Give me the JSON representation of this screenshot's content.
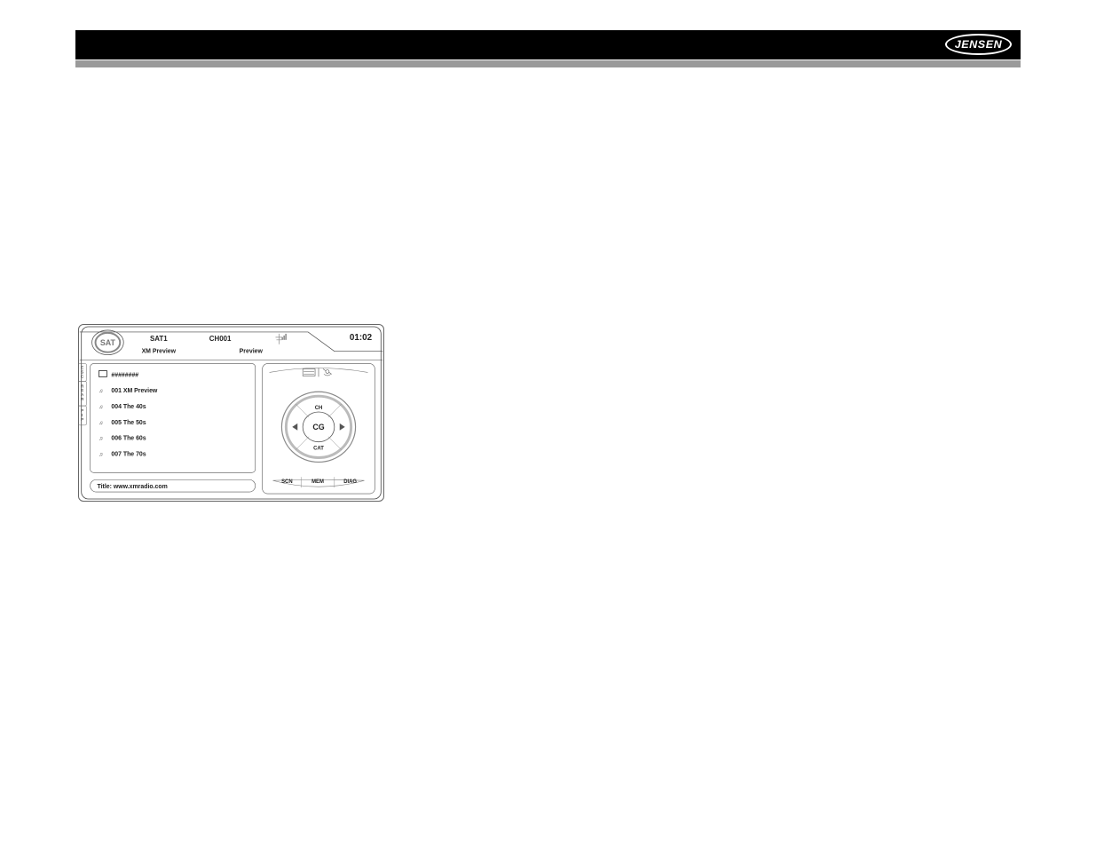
{
  "brand": "JENSEN",
  "screen": {
    "mode_icon": "SAT",
    "band": "SAT1",
    "channel": "CH001",
    "clock": "01:02",
    "category": "XM Preview",
    "now_label": "Preview",
    "side_tabs": [
      "ESC",
      "REAR",
      "PIP"
    ],
    "list": [
      {
        "type": "folder",
        "label": "########"
      },
      {
        "type": "track",
        "label": "001 XM Preview"
      },
      {
        "type": "track",
        "label": "004 The 40s"
      },
      {
        "type": "track",
        "label": "005 The 50s"
      },
      {
        "type": "track",
        "label": "006 The 60s"
      },
      {
        "type": "track",
        "label": "007 The 70s"
      }
    ],
    "footer_title": "Title: www.xmradio.com",
    "dial": {
      "top": "CH",
      "center": "CG",
      "bottom": "CAT"
    },
    "softkeys": [
      "SCN",
      "MEM",
      "DIAG"
    ]
  }
}
